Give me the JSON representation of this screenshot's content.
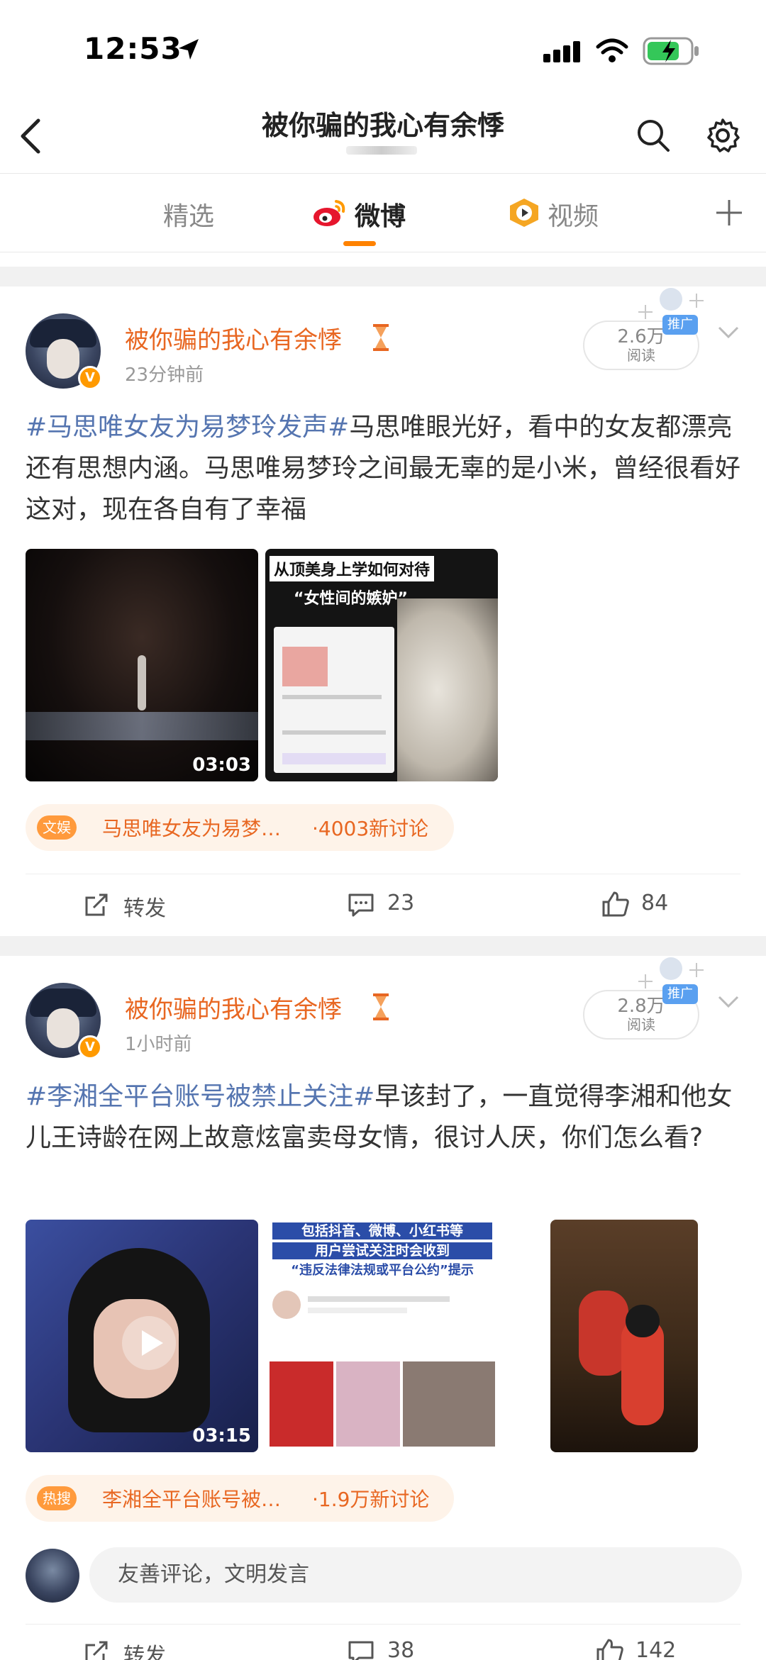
{
  "status": {
    "time": "12:53"
  },
  "header": {
    "title": "被你骗的我心有余悸"
  },
  "tabs": [
    {
      "label": "精选"
    },
    {
      "label": "微博"
    },
    {
      "label": "视频"
    }
  ],
  "posts": [
    {
      "username": "被你骗的我心有余悸",
      "time": "23分钟前",
      "reads_count": "2.6万",
      "reads_label": "阅读",
      "ad_label": "推广",
      "hashtag": "#马思唯女友为易梦玲发声#",
      "body": "马思唯眼光好，看中的女友都漂亮还有思想内涵。马思唯易梦玲之间最无辜的是小米，曾经很看好这对，现在各自有了幸福",
      "video_duration": "03:03",
      "image2_title_line1": "从顶美身上学如何对待",
      "image2_title_line2": "“女性间的嫉妒”",
      "topic_badge": "文娱",
      "topic_title": "马思唯女友为易梦…",
      "topic_count": "·4003新讨论",
      "repost_label": "转发",
      "comment_count": "23",
      "like_count": "84"
    },
    {
      "username": "被你骗的我心有余悸",
      "time": "1小时前",
      "reads_count": "2.8万",
      "reads_label": "阅读",
      "ad_label": "推广",
      "hashtag": "#李湘全平台账号被禁止关注#",
      "body": "早该封了，一直觉得李湘和他女儿王诗龄在网上故意炫富卖母女情，很讨人厌，你们怎么看?",
      "video_duration": "03:15",
      "image2_title_line1": "包括抖音、微博、小红书等",
      "image2_title_line2": "用户尝试关注时会收到",
      "image2_title_line3": "“违反法律法规或平台公约”提示",
      "topic_badge": "热搜",
      "topic_title": "李湘全平台账号被…",
      "topic_count": "·1.9万新讨论",
      "repost_label": "转发",
      "comment_count": "38",
      "like_count": "142"
    }
  ],
  "comment_input": {
    "placeholder": "友善评论，文明发言"
  },
  "colors": {
    "accent": "#ff8200",
    "username": "#e86722",
    "hashtag": "#5575b0"
  }
}
